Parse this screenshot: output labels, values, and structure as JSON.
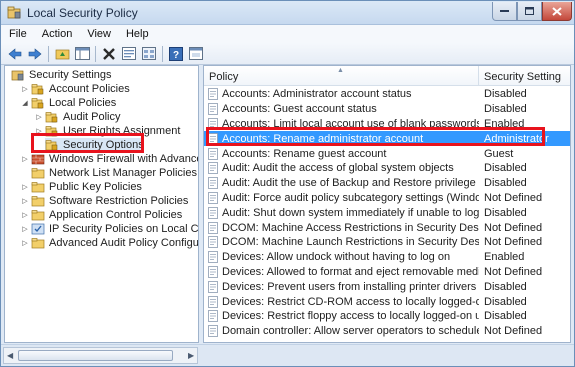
{
  "window": {
    "title": "Local Security Policy",
    "colors": {
      "selection": "#3399ff",
      "highlight_box": "#e8131d"
    }
  },
  "menu": [
    "File",
    "Action",
    "View",
    "Help"
  ],
  "toolbar": {
    "icons": [
      "back-arrow-icon",
      "forward-arrow-icon",
      "up-folder-icon",
      "show-hide-tree-icon",
      "delete-icon",
      "properties-icon",
      "export-list-icon",
      "help-icon",
      "console-icon"
    ]
  },
  "tree": {
    "root": "Security Settings",
    "items": [
      {
        "label": "Account Policies",
        "level": 1,
        "expander": "collapsed"
      },
      {
        "label": "Local Policies",
        "level": 1,
        "expander": "expanded"
      },
      {
        "label": "Audit Policy",
        "level": 2,
        "expander": "collapsed"
      },
      {
        "label": "User Rights Assignment",
        "level": 2,
        "expander": "collapsed"
      },
      {
        "label": "Security Options",
        "level": 2,
        "expander": "none",
        "selected": true
      },
      {
        "label": "Windows Firewall with Advanced Security",
        "level": 1,
        "expander": "collapsed"
      },
      {
        "label": "Network List Manager Policies",
        "level": 1,
        "expander": "none"
      },
      {
        "label": "Public Key Policies",
        "level": 1,
        "expander": "collapsed"
      },
      {
        "label": "Software Restriction Policies",
        "level": 1,
        "expander": "collapsed"
      },
      {
        "label": "Application Control Policies",
        "level": 1,
        "expander": "collapsed"
      },
      {
        "label": "IP Security Policies on Local Computer",
        "level": 1,
        "expander": "collapsed"
      },
      {
        "label": "Advanced Audit Policy Configuration",
        "level": 1,
        "expander": "collapsed"
      }
    ]
  },
  "list": {
    "columns": {
      "policy": "Policy",
      "setting": "Security Setting"
    },
    "rows": [
      {
        "policy": "Accounts: Administrator account status",
        "setting": "Disabled"
      },
      {
        "policy": "Accounts: Guest account status",
        "setting": "Disabled"
      },
      {
        "policy": "Accounts: Limit local account use of blank passwords to co...",
        "setting": "Enabled"
      },
      {
        "policy": "Accounts: Rename administrator account",
        "setting": "Administrator",
        "selected": true
      },
      {
        "policy": "Accounts: Rename guest account",
        "setting": "Guest"
      },
      {
        "policy": "Audit: Audit the access of global system objects",
        "setting": "Disabled"
      },
      {
        "policy": "Audit: Audit the use of Backup and Restore privilege",
        "setting": "Disabled"
      },
      {
        "policy": "Audit: Force audit policy subcategory settings (Windows Vis...",
        "setting": "Not Defined"
      },
      {
        "policy": "Audit: Shut down system immediately if unable to log secur...",
        "setting": "Disabled"
      },
      {
        "policy": "DCOM: Machine Access Restrictions in Security Descriptor D...",
        "setting": "Not Defined"
      },
      {
        "policy": "DCOM: Machine Launch Restrictions in Security Descriptor ...",
        "setting": "Not Defined"
      },
      {
        "policy": "Devices: Allow undock without having to log on",
        "setting": "Enabled"
      },
      {
        "policy": "Devices: Allowed to format and eject removable media",
        "setting": "Not Defined"
      },
      {
        "policy": "Devices: Prevent users from installing printer drivers",
        "setting": "Disabled"
      },
      {
        "policy": "Devices: Restrict CD-ROM access to locally logged-on user ...",
        "setting": "Disabled"
      },
      {
        "policy": "Devices: Restrict floppy access to locally logged-on user only",
        "setting": "Disabled"
      },
      {
        "policy": "Domain controller: Allow server operators to schedule tasks",
        "setting": "Not Defined"
      }
    ]
  }
}
